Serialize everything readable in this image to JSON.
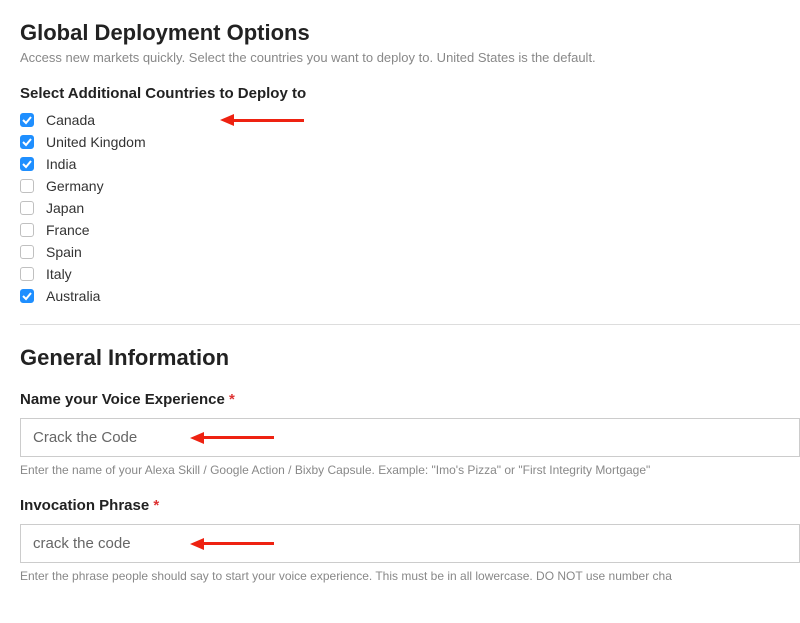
{
  "deployment": {
    "title": "Global Deployment Options",
    "subtitle": "Access new markets quickly. Select the countries you want to deploy to. United States is the default.",
    "section_label": "Select Additional Countries to Deploy to",
    "countries": [
      {
        "label": "Canada",
        "checked": true
      },
      {
        "label": "United Kingdom",
        "checked": true
      },
      {
        "label": "India",
        "checked": true
      },
      {
        "label": "Germany",
        "checked": false
      },
      {
        "label": "Japan",
        "checked": false
      },
      {
        "label": "France",
        "checked": false
      },
      {
        "label": "Spain",
        "checked": false
      },
      {
        "label": "Italy",
        "checked": false
      },
      {
        "label": "Australia",
        "checked": true
      }
    ]
  },
  "general": {
    "title": "General Information",
    "name_field": {
      "label": "Name your Voice Experience",
      "required": "*",
      "value": "Crack the Code",
      "help": "Enter the name of your Alexa Skill / Google Action / Bixby Capsule. Example: \"Imo's Pizza\" or \"First Integrity Mortgage\""
    },
    "invocation_field": {
      "label": "Invocation Phrase",
      "required": "*",
      "value": "crack the code",
      "help": "Enter the phrase people should say to start your voice experience. This must be in all lowercase. DO NOT use number cha"
    }
  }
}
